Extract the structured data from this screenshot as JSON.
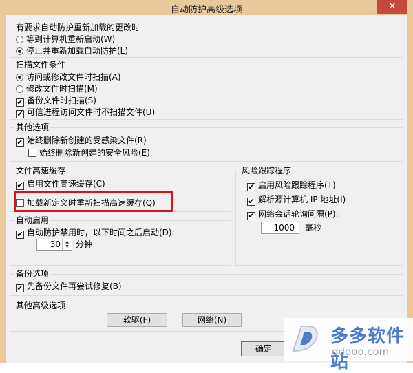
{
  "window": {
    "title": "自动防护高级选项",
    "close_glyph": "✕"
  },
  "restart_group": {
    "label": "有要求自动防护重新加载的更改时",
    "options": [
      {
        "label": "等到计算机重新启动(W)",
        "selected": false
      },
      {
        "label": "停止并重新加载自动防护(L)",
        "selected": true
      }
    ]
  },
  "scan_group": {
    "label": "扫描文件条件",
    "options": [
      {
        "label": "访问或修改文件时扫描(A)",
        "selected": true
      },
      {
        "label": "修改文件时扫描(M)",
        "selected": false
      }
    ],
    "checks": [
      {
        "label": "备份文件时扫描(S)",
        "checked": true
      },
      {
        "label": "可信进程访问文件时不扫描文件(U)",
        "checked": true
      }
    ]
  },
  "other_group": {
    "label": "其他选项",
    "checks": [
      {
        "label": "始终删除新创建的受感染文件(R)",
        "checked": true
      },
      {
        "label": "始终删除新创建的安全风险(E)",
        "checked": false
      }
    ]
  },
  "cache_group": {
    "label": "文件高速缓存",
    "checks": [
      {
        "label": "启用文件高速缓存(C)",
        "checked": true
      },
      {
        "label": "加载新定义时重新扫描高速缓存(Q)",
        "checked": false
      }
    ]
  },
  "autostart_group": {
    "label": "自动启用",
    "check_label": "自动防护禁用时，以下时间之后启动(D):",
    "checked": true,
    "minutes_value": "30",
    "minutes_unit": "分钟"
  },
  "risk_group": {
    "label": "风险跟踪程序",
    "checks": [
      {
        "label": "启用风险跟踪程序(T)",
        "checked": true
      },
      {
        "label": "解析源计算机 IP 地址(I)",
        "checked": true
      },
      {
        "label": "网络会话轮询间隔(P):",
        "checked": true
      }
    ],
    "interval_value": "1000",
    "interval_unit": "毫秒"
  },
  "backup_group": {
    "label": "备份选项",
    "check_label": "先备份文件再尝试修复(B)",
    "checked": true
  },
  "advanced_group": {
    "label": "其他高级选项",
    "buttons": [
      "软驱(F)",
      "网络(N)"
    ]
  },
  "footer": {
    "ok_label": "确定"
  },
  "watermark": {
    "line1": "多多软件站",
    "line2": "ddooo.com"
  },
  "colors": {
    "titlebar": "#e9c89a",
    "close": "#c7483c",
    "highlight": "#d6141a",
    "watermark_blue": "#4b7ccd"
  },
  "glyphs": {
    "check": "✔",
    "spin_up": "▲",
    "spin_down": "▼"
  }
}
